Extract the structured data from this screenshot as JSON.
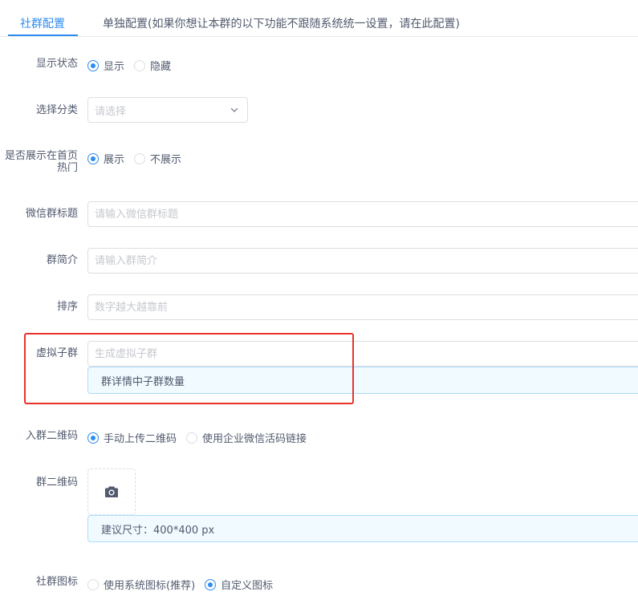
{
  "tabs": [
    {
      "label": "社群配置",
      "active": true
    },
    {
      "label": "单独配置(如果你想让本群的以下功能不跟随系统统一设置，请在此配置)",
      "active": false
    }
  ],
  "form": {
    "display_status": {
      "label": "显示状态",
      "options": [
        "显示",
        "隐藏"
      ],
      "selected": "显示"
    },
    "category": {
      "label": "选择分类",
      "placeholder": "请选择"
    },
    "show_homepage_hot": {
      "label": "是否展示在首页热门",
      "options": [
        "展示",
        "不展示"
      ],
      "selected": "展示"
    },
    "wechat_group_title": {
      "label": "微信群标题",
      "placeholder": "请输入微信群标题"
    },
    "group_intro": {
      "label": "群简介",
      "placeholder": "请输入群简介"
    },
    "sort": {
      "label": "排序",
      "placeholder": "数字越大越靠前"
    },
    "virtual_subgroup": {
      "label": "虚拟子群",
      "placeholder": "生成虚拟子群",
      "tip": "群详情中子群数量"
    },
    "join_qrcode": {
      "label": "入群二维码",
      "options": [
        "手动上传二维码",
        "使用企业微信活码链接"
      ],
      "selected": "手动上传二维码"
    },
    "group_qrcode": {
      "label": "群二维码",
      "tip": "建议尺寸：400*400 px"
    },
    "group_icon": {
      "label": "社群图标",
      "options": [
        "使用系统图标(推荐)",
        "自定义图标"
      ],
      "selected": "自定义图标"
    }
  },
  "colors": {
    "accent": "#2d8cf0",
    "highlight_border": "#e8332c",
    "tip_bg": "#f0faff"
  },
  "icons": {
    "upload": "camera-icon",
    "select": "chevron-down-icon"
  }
}
